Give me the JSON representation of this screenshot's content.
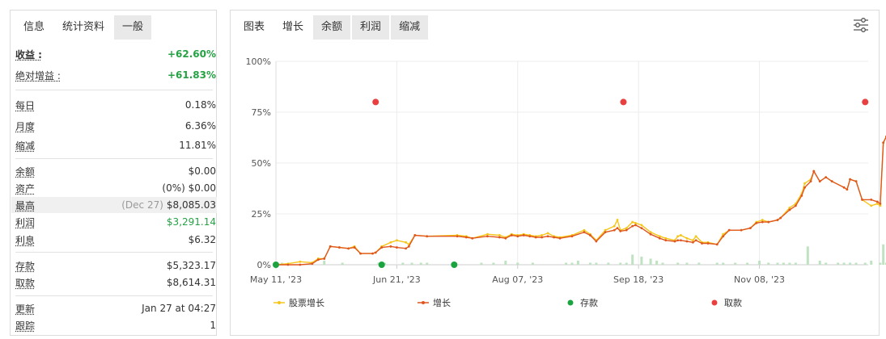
{
  "left_tabs": [
    {
      "label": "信息"
    },
    {
      "label": "统计资料"
    },
    {
      "label": "一般"
    }
  ],
  "stats": {
    "profit": {
      "label": "收益 :",
      "value": "+62.60%"
    },
    "abs_gain": {
      "label": "绝对增益 :",
      "value": "+61.83%"
    },
    "daily": {
      "label": "每日",
      "value": "0.18%"
    },
    "monthly": {
      "label": "月度",
      "value": "6.36%"
    },
    "drawdown": {
      "label": "缩减",
      "value": "11.81%"
    },
    "balance": {
      "label": "余额",
      "value": "$0.00"
    },
    "equity": {
      "label": "资产",
      "value": "(0%) $0.00"
    },
    "highest": {
      "label": "最高",
      "date": "(Dec 27)",
      "value": "$8,085.03"
    },
    "profit_amount": {
      "label": "利润",
      "value": "$3,291.14"
    },
    "interest": {
      "label": "利息",
      "value": "$6.32"
    },
    "deposits": {
      "label": "存款",
      "value": "$5,323.17"
    },
    "withdrawals": {
      "label": "取款",
      "value": "$8,614.31"
    },
    "updated": {
      "label": "更新",
      "value": "Jan 27 at 04:27"
    },
    "tracking": {
      "label": "跟踪",
      "value": "1"
    }
  },
  "chart_tabs": [
    {
      "label": "图表"
    },
    {
      "label": "增长"
    },
    {
      "label": "余额"
    },
    {
      "label": "利润"
    },
    {
      "label": "缩减"
    }
  ],
  "icons": {
    "settings": "sliders-icon"
  },
  "colors": {
    "growth": "#e0561f",
    "equity_growth": "#f5c518",
    "deposit": "#1aa33f",
    "withdrawal": "#e84040",
    "volume": "#bfe3c2"
  },
  "chart_data": {
    "type": "line",
    "y_ticks": [
      "100%",
      "75%",
      "50%",
      "25%",
      "0%"
    ],
    "ylim": [
      0,
      100
    ],
    "x_ticks": [
      "May 11, '23",
      "Jun 21, '23",
      "Aug 07, '23",
      "Sep 18, '23",
      "Nov 08, '23"
    ],
    "x_tick_index": [
      0,
      40,
      80,
      120,
      160
    ],
    "x_count": 197,
    "grid": true,
    "legend_position": "bottom",
    "series": [
      {
        "name": "股票增长",
        "key": "equity",
        "points": [
          [
            0,
            0
          ],
          [
            4,
            0.5
          ],
          [
            8,
            1.5
          ],
          [
            12,
            1
          ],
          [
            14,
            3
          ],
          [
            16,
            3
          ],
          [
            18,
            9
          ],
          [
            21,
            8.5
          ],
          [
            24,
            8
          ],
          [
            26,
            9
          ],
          [
            28,
            5.5
          ],
          [
            32,
            5.5
          ],
          [
            33,
            6
          ],
          [
            35,
            9
          ],
          [
            38,
            11
          ],
          [
            40,
            12
          ],
          [
            43,
            11
          ],
          [
            44,
            10
          ],
          [
            46,
            14.5
          ],
          [
            50,
            14
          ],
          [
            60,
            14.5
          ],
          [
            63,
            14
          ],
          [
            65,
            13
          ],
          [
            70,
            15
          ],
          [
            74,
            14.5
          ],
          [
            76,
            13.5
          ],
          [
            78,
            15
          ],
          [
            80,
            14.5
          ],
          [
            82,
            15
          ],
          [
            84,
            14.5
          ],
          [
            86,
            14
          ],
          [
            88,
            14.5
          ],
          [
            90,
            15.5
          ],
          [
            92,
            14
          ],
          [
            94,
            13.5
          ],
          [
            98,
            14.5
          ],
          [
            102,
            17
          ],
          [
            104,
            15
          ],
          [
            106,
            12
          ],
          [
            109,
            17
          ],
          [
            112,
            19
          ],
          [
            113,
            22
          ],
          [
            114,
            17
          ],
          [
            116,
            18
          ],
          [
            118,
            21
          ],
          [
            119,
            20.5
          ],
          [
            121,
            19.5
          ],
          [
            124,
            16
          ],
          [
            127,
            14
          ],
          [
            129,
            13
          ],
          [
            132,
            12
          ],
          [
            133,
            14
          ],
          [
            134,
            14.5
          ],
          [
            136,
            13
          ],
          [
            138,
            12
          ],
          [
            139,
            14
          ],
          [
            141,
            11
          ],
          [
            143,
            11
          ],
          [
            146,
            10
          ],
          [
            148,
            15
          ],
          [
            150,
            17
          ],
          [
            154,
            17
          ],
          [
            157,
            18
          ],
          [
            159,
            21
          ],
          [
            161,
            22
          ],
          [
            163,
            21
          ],
          [
            166,
            22
          ],
          [
            167,
            23
          ],
          [
            170,
            28
          ],
          [
            172,
            30
          ],
          [
            174,
            35
          ],
          [
            175,
            40
          ],
          [
            177,
            42
          ],
          [
            178,
            46
          ],
          [
            180,
            41
          ],
          [
            182,
            43
          ],
          [
            184,
            41
          ],
          [
            188,
            38
          ],
          [
            189,
            37
          ],
          [
            190,
            42
          ],
          [
            192,
            41
          ],
          [
            194,
            32
          ],
          [
            197,
            29
          ],
          [
            199,
            30
          ],
          [
            200,
            29
          ],
          [
            201,
            60
          ],
          [
            202,
            63
          ]
        ]
      },
      {
        "name": "增长",
        "key": "growth",
        "points": [
          [
            0,
            0
          ],
          [
            4,
            0
          ],
          [
            8,
            0
          ],
          [
            12,
            0.5
          ],
          [
            14,
            2.5
          ],
          [
            16,
            3
          ],
          [
            18,
            9
          ],
          [
            21,
            8.5
          ],
          [
            24,
            8
          ],
          [
            26,
            8.5
          ],
          [
            28,
            5.5
          ],
          [
            32,
            5.5
          ],
          [
            33,
            6
          ],
          [
            35,
            8.5
          ],
          [
            38,
            9
          ],
          [
            40,
            8.5
          ],
          [
            43,
            8
          ],
          [
            44,
            9
          ],
          [
            46,
            14.5
          ],
          [
            50,
            14
          ],
          [
            60,
            14
          ],
          [
            63,
            13.5
          ],
          [
            65,
            13
          ],
          [
            70,
            14
          ],
          [
            74,
            13.5
          ],
          [
            76,
            13
          ],
          [
            78,
            14.5
          ],
          [
            80,
            14
          ],
          [
            82,
            14.5
          ],
          [
            84,
            14
          ],
          [
            86,
            13.5
          ],
          [
            88,
            13.5
          ],
          [
            90,
            14
          ],
          [
            92,
            13.5
          ],
          [
            94,
            13
          ],
          [
            98,
            14
          ],
          [
            102,
            16
          ],
          [
            104,
            14.5
          ],
          [
            106,
            11.5
          ],
          [
            109,
            16
          ],
          [
            112,
            17
          ],
          [
            113,
            18
          ],
          [
            114,
            16.5
          ],
          [
            116,
            17
          ],
          [
            118,
            19
          ],
          [
            119,
            19.5
          ],
          [
            121,
            18
          ],
          [
            124,
            15
          ],
          [
            127,
            13
          ],
          [
            129,
            12
          ],
          [
            132,
            11.5
          ],
          [
            133,
            12
          ],
          [
            134,
            12
          ],
          [
            136,
            11.5
          ],
          [
            138,
            11
          ],
          [
            139,
            12
          ],
          [
            141,
            10.5
          ],
          [
            143,
            10.5
          ],
          [
            146,
            10
          ],
          [
            148,
            14
          ],
          [
            150,
            17
          ],
          [
            154,
            17
          ],
          [
            157,
            18
          ],
          [
            159,
            20.5
          ],
          [
            161,
            21
          ],
          [
            163,
            21
          ],
          [
            166,
            22
          ],
          [
            167,
            23
          ],
          [
            170,
            27
          ],
          [
            172,
            29
          ],
          [
            174,
            34
          ],
          [
            175,
            38
          ],
          [
            177,
            41
          ],
          [
            178,
            46
          ],
          [
            180,
            41
          ],
          [
            182,
            43
          ],
          [
            184,
            41
          ],
          [
            188,
            38
          ],
          [
            189,
            37
          ],
          [
            190,
            42
          ],
          [
            192,
            41
          ],
          [
            194,
            32
          ],
          [
            197,
            32
          ],
          [
            199,
            31
          ],
          [
            200,
            30
          ],
          [
            201,
            60
          ],
          [
            202,
            63
          ]
        ]
      }
    ],
    "deposits_x": [
      0,
      35,
      59
    ],
    "deposits_y": 0,
    "withdrawals_x": [
      33,
      115,
      195
    ],
    "withdrawals_y": 80,
    "volume_bars": [
      [
        2,
        1
      ],
      [
        12,
        1
      ],
      [
        16,
        2
      ],
      [
        22,
        1
      ],
      [
        34,
        1
      ],
      [
        36,
        1
      ],
      [
        42,
        1
      ],
      [
        45,
        1
      ],
      [
        48,
        1
      ],
      [
        50,
        1
      ],
      [
        68,
        1
      ],
      [
        72,
        1
      ],
      [
        76,
        2
      ],
      [
        80,
        1
      ],
      [
        85,
        1
      ],
      [
        96,
        1
      ],
      [
        98,
        1
      ],
      [
        100,
        2
      ],
      [
        104,
        1
      ],
      [
        106,
        1
      ],
      [
        110,
        1
      ],
      [
        114,
        1
      ],
      [
        116,
        1
      ],
      [
        118,
        5
      ],
      [
        121,
        4
      ],
      [
        124,
        3
      ],
      [
        126,
        2
      ],
      [
        128,
        1
      ],
      [
        133,
        1
      ],
      [
        136,
        1
      ],
      [
        140,
        1
      ],
      [
        146,
        1
      ],
      [
        148,
        1
      ],
      [
        152,
        1
      ],
      [
        156,
        1
      ],
      [
        160,
        2
      ],
      [
        163,
        1
      ],
      [
        166,
        1
      ],
      [
        168,
        1
      ],
      [
        170,
        1
      ],
      [
        172,
        1
      ],
      [
        176,
        9
      ],
      [
        180,
        2
      ],
      [
        182,
        1
      ],
      [
        186,
        1
      ],
      [
        188,
        1
      ],
      [
        190,
        1
      ],
      [
        192,
        1
      ],
      [
        195,
        1
      ],
      [
        197,
        2
      ],
      [
        200,
        1
      ],
      [
        201,
        10
      ],
      [
        202,
        1
      ],
      [
        205,
        1
      ],
      [
        208,
        2
      ],
      [
        210,
        6
      ],
      [
        212,
        1
      ],
      [
        215,
        5
      ],
      [
        216,
        2
      ],
      [
        218,
        3
      ],
      [
        220,
        1
      ],
      [
        222,
        4
      ],
      [
        224,
        3
      ],
      [
        226,
        1
      ],
      [
        228,
        1
      ],
      [
        230,
        2
      ],
      [
        232,
        1
      ],
      [
        233,
        1
      ]
    ],
    "legend": [
      {
        "label": "股票增长",
        "key": "equity"
      },
      {
        "label": "增长",
        "key": "growth"
      },
      {
        "label": "存款",
        "key": "deposit"
      },
      {
        "label": "取款",
        "key": "withdrawal"
      }
    ]
  }
}
